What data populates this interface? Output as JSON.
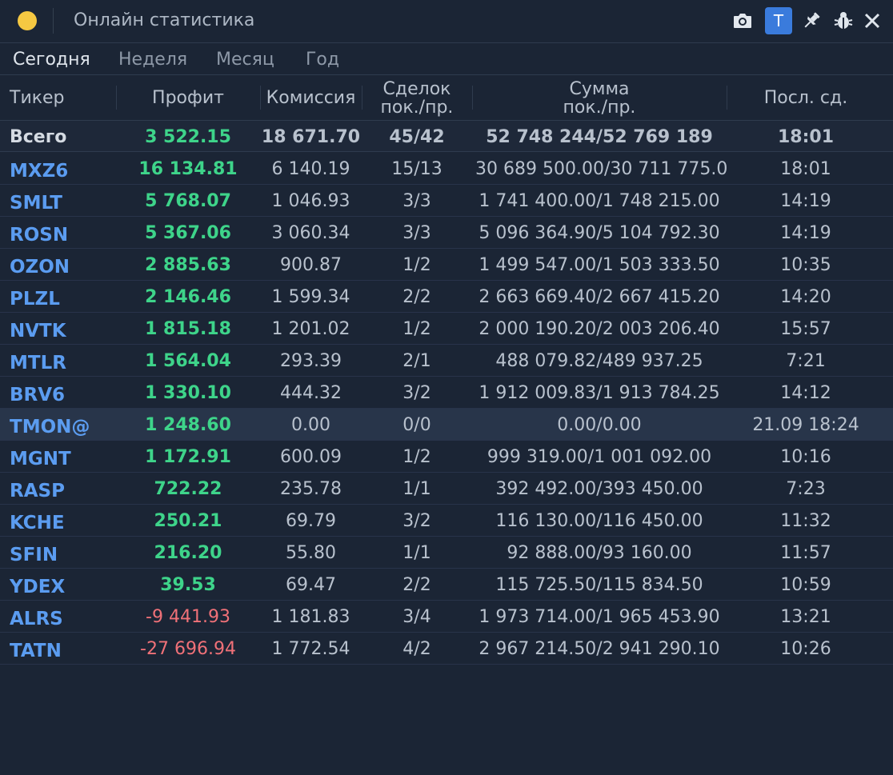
{
  "window": {
    "title": "Онлайн статистика",
    "status_color": "#f5c842",
    "toolbar": [
      {
        "name": "camera-icon"
      },
      {
        "name": "t-button",
        "label": "T"
      },
      {
        "name": "pin-icon"
      },
      {
        "name": "bug-icon"
      },
      {
        "name": "close-icon"
      }
    ]
  },
  "tabs": [
    {
      "label": "Сегодня",
      "active": true
    },
    {
      "label": "Неделя",
      "active": false
    },
    {
      "label": "Месяц",
      "active": false
    },
    {
      "label": "Год",
      "active": false
    }
  ],
  "columns": {
    "ticker": "Тикер",
    "profit": "Профит",
    "commission": "Комиссия",
    "deals_line1": "Сделок",
    "deals_line2": "пок./пр.",
    "sum_line1": "Сумма",
    "sum_line2": "пок./пр.",
    "last": "Посл. сд."
  },
  "total": {
    "ticker": "Всего",
    "profit": "3 522.15",
    "commission": "18 671.70",
    "deals": "45/42",
    "sum": "52 748 244/52 769 189",
    "last": "18:01"
  },
  "rows": [
    {
      "ticker": "MXZ6",
      "profit": "16 134.81",
      "commission": "6 140.19",
      "deals": "15/13",
      "sum": "30 689 500.00/30 711 775.00",
      "last": "18:01",
      "negative": false,
      "highlight": false
    },
    {
      "ticker": "SMLT",
      "profit": "5 768.07",
      "commission": "1 046.93",
      "deals": "3/3",
      "sum": "1 741 400.00/1 748 215.00",
      "last": "14:19",
      "negative": false,
      "highlight": false
    },
    {
      "ticker": "ROSN",
      "profit": "5 367.06",
      "commission": "3 060.34",
      "deals": "3/3",
      "sum": "5 096 364.90/5 104 792.30",
      "last": "14:19",
      "negative": false,
      "highlight": false
    },
    {
      "ticker": "OZON",
      "profit": "2 885.63",
      "commission": "900.87",
      "deals": "1/2",
      "sum": "1 499 547.00/1 503 333.50",
      "last": "10:35",
      "negative": false,
      "highlight": false
    },
    {
      "ticker": "PLZL",
      "profit": "2 146.46",
      "commission": "1 599.34",
      "deals": "2/2",
      "sum": "2 663 669.40/2 667 415.20",
      "last": "14:20",
      "negative": false,
      "highlight": false
    },
    {
      "ticker": "NVTK",
      "profit": "1 815.18",
      "commission": "1 201.02",
      "deals": "1/2",
      "sum": "2 000 190.20/2 003 206.40",
      "last": "15:57",
      "negative": false,
      "highlight": false
    },
    {
      "ticker": "MTLR",
      "profit": "1 564.04",
      "commission": "293.39",
      "deals": "2/1",
      "sum": "488 079.82/489 937.25",
      "last": "7:21",
      "negative": false,
      "highlight": false
    },
    {
      "ticker": "BRV6",
      "profit": "1 330.10",
      "commission": "444.32",
      "deals": "3/2",
      "sum": "1 912 009.83/1 913 784.25",
      "last": "14:12",
      "negative": false,
      "highlight": false
    },
    {
      "ticker": "TMON@",
      "profit": "1 248.60",
      "commission": "0.00",
      "deals": "0/0",
      "sum": "0.00/0.00",
      "last": "21.09 18:24",
      "negative": false,
      "highlight": true
    },
    {
      "ticker": "MGNT",
      "profit": "1 172.91",
      "commission": "600.09",
      "deals": "1/2",
      "sum": "999 319.00/1 001 092.00",
      "last": "10:16",
      "negative": false,
      "highlight": false
    },
    {
      "ticker": "RASP",
      "profit": "722.22",
      "commission": "235.78",
      "deals": "1/1",
      "sum": "392 492.00/393 450.00",
      "last": "7:23",
      "negative": false,
      "highlight": false
    },
    {
      "ticker": "KCHE",
      "profit": "250.21",
      "commission": "69.79",
      "deals": "3/2",
      "sum": "116 130.00/116 450.00",
      "last": "11:32",
      "negative": false,
      "highlight": false
    },
    {
      "ticker": "SFIN",
      "profit": "216.20",
      "commission": "55.80",
      "deals": "1/1",
      "sum": "92 888.00/93 160.00",
      "last": "11:57",
      "negative": false,
      "highlight": false
    },
    {
      "ticker": "YDEX",
      "profit": "39.53",
      "commission": "69.47",
      "deals": "2/2",
      "sum": "115 725.50/115 834.50",
      "last": "10:59",
      "negative": false,
      "highlight": false
    },
    {
      "ticker": "ALRS",
      "profit": "-9 441.93",
      "commission": "1 181.83",
      "deals": "3/4",
      "sum": "1 973 714.00/1 965 453.90",
      "last": "13:21",
      "negative": true,
      "highlight": false
    },
    {
      "ticker": "TATN",
      "profit": "-27 696.94",
      "commission": "1 772.54",
      "deals": "4/2",
      "sum": "2 967 214.50/2 941 290.10",
      "last": "10:26",
      "negative": true,
      "highlight": false
    }
  ]
}
